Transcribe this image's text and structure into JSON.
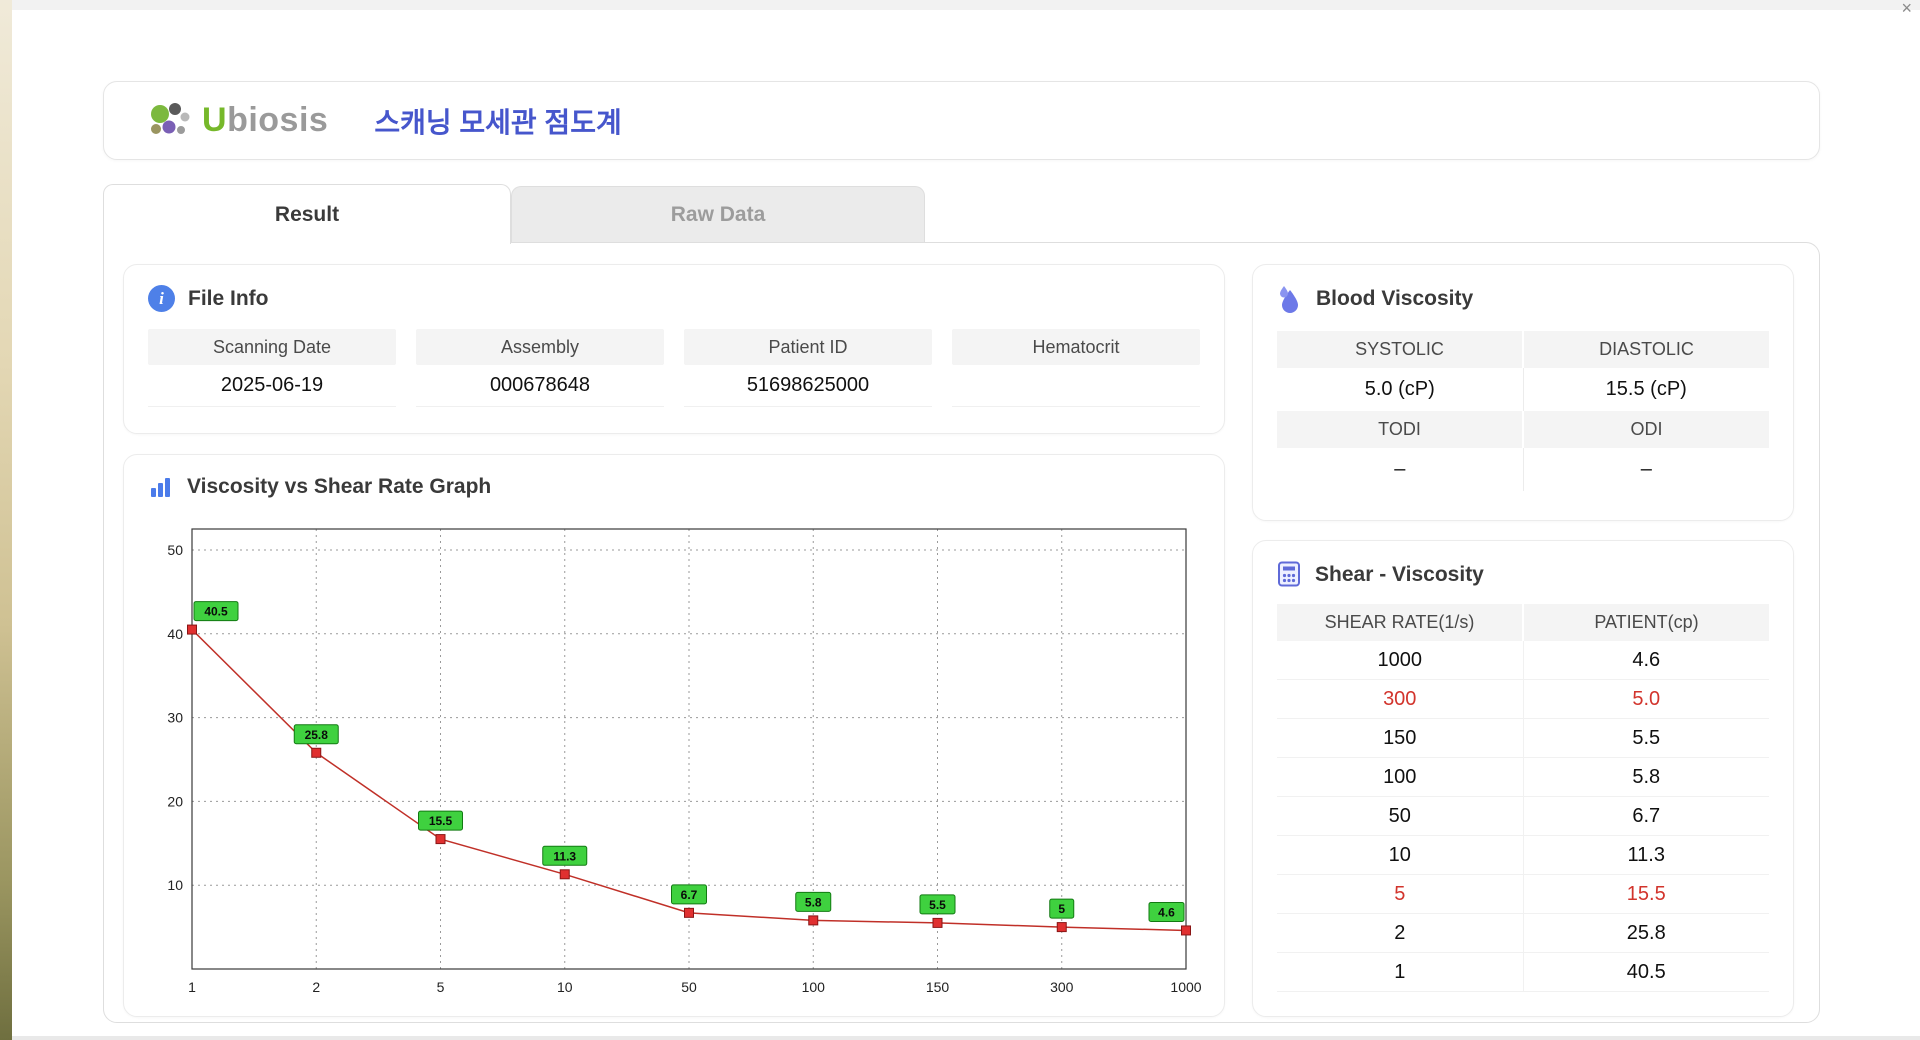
{
  "window": {
    "close_icon": "×"
  },
  "header": {
    "logo_u": "U",
    "logo_rest": "biosis",
    "title": "스캐닝 모세관 점도계"
  },
  "tabs": {
    "result": "Result",
    "raw_data": "Raw Data"
  },
  "file_info": {
    "title": "File Info",
    "fields": [
      {
        "label": "Scanning Date",
        "value": "2025-06-19"
      },
      {
        "label": "Assembly",
        "value": "000678648"
      },
      {
        "label": "Patient ID",
        "value": "51698625000"
      },
      {
        "label": "Hematocrit",
        "value": ""
      }
    ]
  },
  "graph_section": {
    "title": "Viscosity vs Shear Rate Graph"
  },
  "chart_data": {
    "type": "line",
    "title": "Viscosity vs Shear Rate Graph",
    "x_scale": "categorical (log-spaced shear rates, 1/s)",
    "categories": [
      "1",
      "2",
      "5",
      "10",
      "50",
      "100",
      "150",
      "300",
      "1000"
    ],
    "values": [
      40.5,
      25.8,
      15.5,
      11.3,
      6.7,
      5.8,
      5.5,
      5,
      4.6
    ],
    "point_labels": [
      "40.5",
      "25.8",
      "15.5",
      "11.3",
      "6.7",
      "5.8",
      "5.5",
      "5",
      "4.6"
    ],
    "xlabel": "",
    "ylabel": "",
    "y_ticks": [
      10,
      20,
      30,
      40,
      50
    ],
    "ylim": [
      0,
      52.5
    ],
    "grid": true,
    "legend": "none",
    "line_color": "#c03028",
    "marker_color": "#e03030",
    "label_bg": "#3fd13f",
    "label_border": "#127a12"
  },
  "blood_viscosity": {
    "title": "Blood Viscosity",
    "pairs": [
      {
        "labels": [
          "SYSTOLIC",
          "DIASTOLIC"
        ],
        "values": [
          "5.0 (cP)",
          "15.5 (cP)"
        ]
      },
      {
        "labels": [
          "TODI",
          "ODI"
        ],
        "values": [
          "–",
          "–"
        ]
      }
    ]
  },
  "shear_viscosity": {
    "title": "Shear - Viscosity",
    "columns": [
      "SHEAR RATE(1/s)",
      "PATIENT(cp)"
    ],
    "highlight_color": "#d2342c",
    "rows": [
      {
        "shear_rate": "1000",
        "patient": "4.6",
        "highlight": false
      },
      {
        "shear_rate": "300",
        "patient": "5.0",
        "highlight": true
      },
      {
        "shear_rate": "150",
        "patient": "5.5",
        "highlight": false
      },
      {
        "shear_rate": "100",
        "patient": "5.8",
        "highlight": false
      },
      {
        "shear_rate": "50",
        "patient": "6.7",
        "highlight": false
      },
      {
        "shear_rate": "10",
        "patient": "11.3",
        "highlight": false
      },
      {
        "shear_rate": "5",
        "patient": "15.5",
        "highlight": true
      },
      {
        "shear_rate": "2",
        "patient": "25.8",
        "highlight": false
      },
      {
        "shear_rate": "1",
        "patient": "40.5",
        "highlight": false
      }
    ]
  }
}
